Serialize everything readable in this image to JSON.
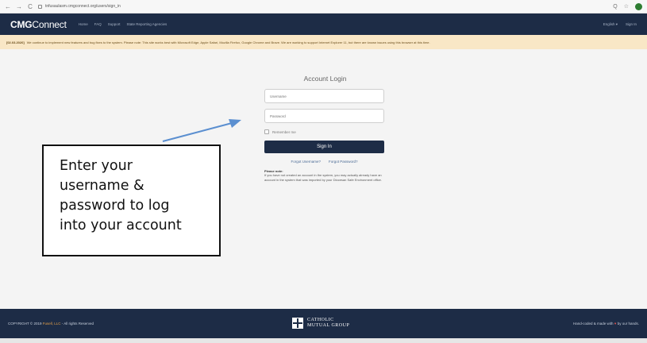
{
  "browser": {
    "url": "tnfusaulasm.cmgconnect.org/users/sign_in",
    "back_icon": "←",
    "forward_icon": "→",
    "reload_icon": "C",
    "zoom_icon": "Q",
    "star_icon": "☆"
  },
  "navbar": {
    "logo_bold": "CMG",
    "logo_rest": "Connect",
    "links": [
      "Home",
      "FAQ",
      "Support",
      "State Reporting Agencies"
    ],
    "language": "English ▾",
    "sign_in": "Sign In"
  },
  "notice": {
    "date": "[02.03.2020]",
    "text": "We continue to implement new features and bug fixes to the system. Please note: This site works best with Microsoft Edge, Apple Safari, Mozilla Firefox, Google Chrome and Brave. We are working to support Internet Explorer 11, but there are known issues using this browser at this time."
  },
  "login": {
    "title": "Account Login",
    "username_placeholder": "Username",
    "password_placeholder": "Password",
    "remember_label": "Remember me",
    "signin_label": "Sign In",
    "forgot_username": "Forgot Username?",
    "forgot_password": "Forgot Password?",
    "note_heading": "Please note:",
    "note_text": "If you have not created an account in the system, you may actually already have an account in the system that was imported by your Diocesan Safe Environment office."
  },
  "callout": {
    "lines": [
      "Enter your",
      "username &",
      "password to log",
      "into your account"
    ]
  },
  "footer": {
    "copyright_prefix": "COPYRIGHT © 2019",
    "copyright_brand": "Fusell, LLC",
    "copyright_suffix": "- All rights Reserved",
    "logo_line1": "CATHOLIC",
    "logo_line2": "MUTUAL GROUP",
    "right_prefix": "Hand-coded & made with",
    "right_heart": "♥",
    "right_suffix": "by our hands."
  },
  "colors": {
    "navy": "#1d2c46",
    "notice_bg": "#f9e7c6",
    "arrow": "#5b8fd0"
  }
}
